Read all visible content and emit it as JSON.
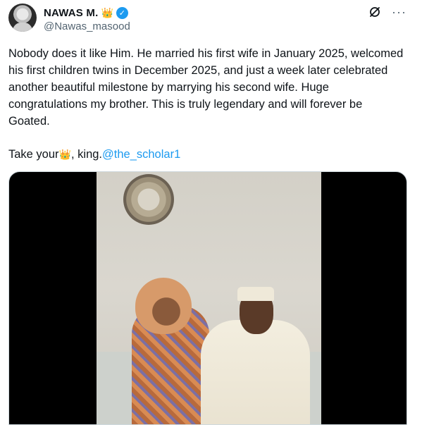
{
  "author": {
    "display_name": "NAWAS M.",
    "crown": "👑",
    "handle": "@Nawas_masood"
  },
  "actions": {
    "grok_icon": "grok-icon",
    "more_icon": "ellipsis-icon",
    "more_glyph": "···"
  },
  "tweet": {
    "body": "Nobody does it like Him. He married his first wife in January 2025, welcomed his first children twins in December 2025, and just a week later celebrated another beautiful milestone by marrying his second wife. Huge congratulations my brother. This is truly legendary and will forever be Goated.",
    "take_prefix": "Take your ",
    "take_crown": "👑",
    "take_suffix": ", king. ",
    "mention": "@the_scholar1"
  },
  "colors": {
    "accent": "#1d9bf0",
    "text": "#0f1419",
    "muted": "#536471"
  }
}
